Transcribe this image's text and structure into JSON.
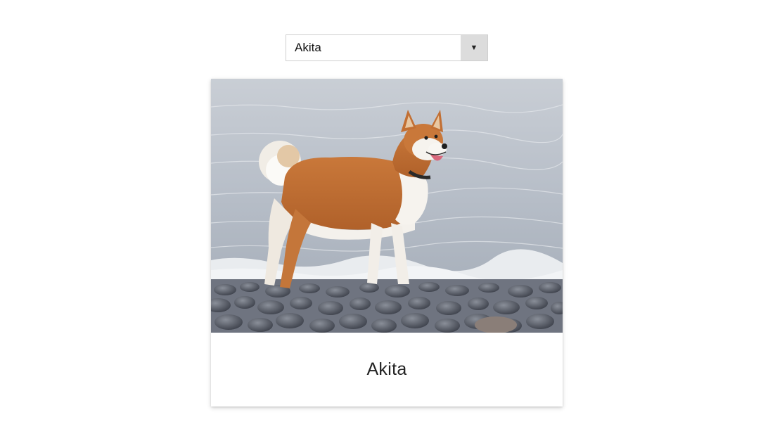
{
  "breed_select": {
    "selected": "Akita",
    "arrow_glyph": "▼"
  },
  "card": {
    "image_icon": "akita-dog-photo",
    "caption": "Akita"
  }
}
